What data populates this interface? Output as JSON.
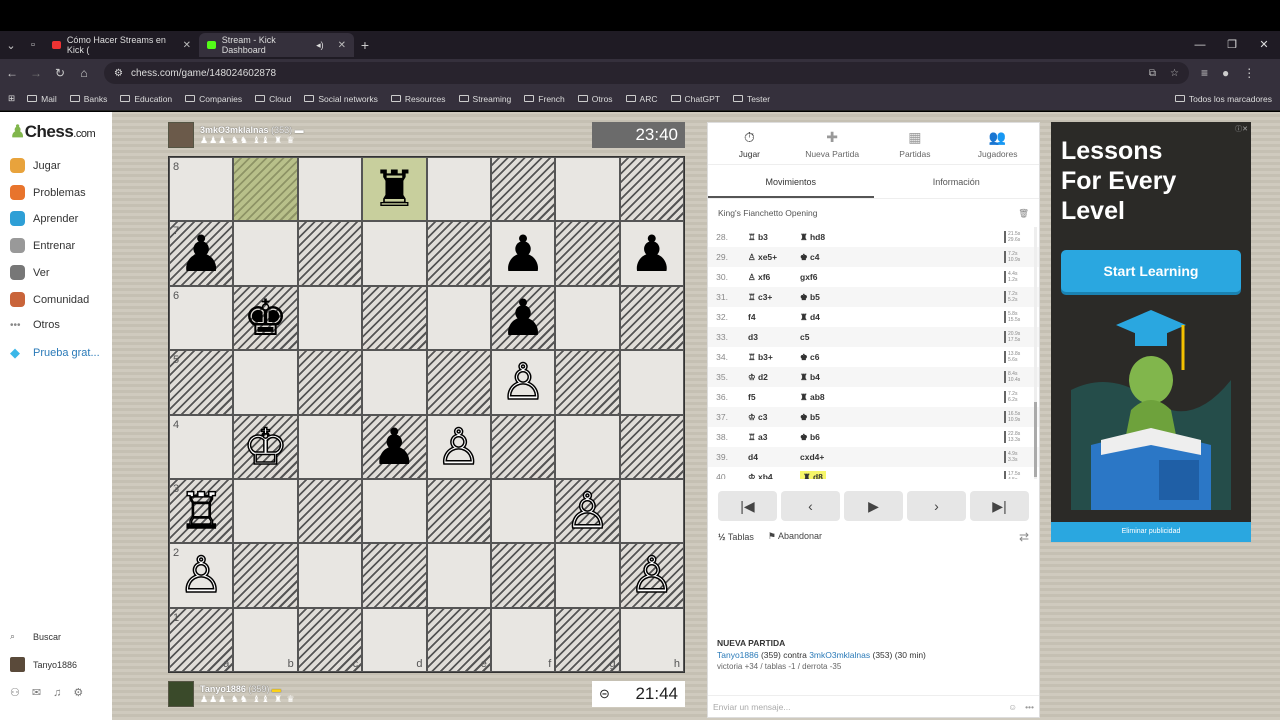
{
  "browser": {
    "tabs": [
      {
        "title": "Cómo Hacer Streams en Kick (",
        "active": false
      },
      {
        "title": "Stream - Kick Dashboard",
        "active": true
      }
    ],
    "url": "chess.com/game/148024602878",
    "bookmarks": [
      "Mail",
      "Banks",
      "Education",
      "Companies",
      "Cloud",
      "Social networks",
      "Resources",
      "Streaming",
      "French",
      "Otros",
      "ARC",
      "ChatGPT",
      "Tester"
    ],
    "bookmarks_right": "Todos los marcadores"
  },
  "sidebar": {
    "logo": "Chess",
    "logo_suffix": ".com",
    "items": [
      "Jugar",
      "Problemas",
      "Aprender",
      "Entrenar",
      "Ver",
      "Comunidad",
      "Otros",
      "Prueba grat..."
    ],
    "search": "Buscar",
    "user": "Tanyo1886"
  },
  "game": {
    "top_player": {
      "name": "3mkO3mklalnas",
      "rating": "(353)",
      "clock": "23:40"
    },
    "bottom_player": {
      "name": "Tanyo1886",
      "rating": "(359)",
      "clock": "21:44"
    },
    "ranks": [
      "8",
      "7",
      "6",
      "5",
      "4",
      "3",
      "2",
      "1"
    ],
    "files": [
      "a",
      "b",
      "c",
      "d",
      "e",
      "f",
      "g",
      "h"
    ]
  },
  "panel": {
    "tabs": [
      {
        "label": "Jugar",
        "icon": "stopwatch-icon",
        "glyph": "⏱"
      },
      {
        "label": "Nueva Partida",
        "icon": "plus-icon",
        "glyph": "✚"
      },
      {
        "label": "Partidas",
        "icon": "board-icon",
        "glyph": "▦"
      },
      {
        "label": "Jugadores",
        "icon": "users-icon",
        "glyph": "👥"
      }
    ],
    "subtabs": [
      "Movimientos",
      "Información"
    ],
    "opening": "King's Fianchetto Opening",
    "moves": [
      {
        "n": "28.",
        "w": "♖ b3",
        "b": "♜ hd8",
        "tw": "21.5s",
        "tb": "29.6s"
      },
      {
        "n": "29.",
        "w": "♙ xe5+",
        "b": "♚ c4",
        "tw": "7.2s",
        "tb": "10.9s"
      },
      {
        "n": "30.",
        "w": "♙ xf6",
        "b": "gxf6",
        "tw": "4.4s",
        "tb": "1.2s"
      },
      {
        "n": "31.",
        "w": "♖ c3+",
        "b": "♚ b5",
        "tw": "7.2s",
        "tb": "5.2s"
      },
      {
        "n": "32.",
        "w": "f4",
        "b": "♜ d4",
        "tw": "5.8s",
        "tb": "15.5s"
      },
      {
        "n": "33.",
        "w": "d3",
        "b": "c5",
        "tw": "20.9s",
        "tb": "17.5s"
      },
      {
        "n": "34.",
        "w": "♖ b3+",
        "b": "♚ c6",
        "tw": "13.8s",
        "tb": "5.6s"
      },
      {
        "n": "35.",
        "w": "♔ d2",
        "b": "♜ b4",
        "tw": "8.4s",
        "tb": "10.4s"
      },
      {
        "n": "36.",
        "w": "f5",
        "b": "♜ ab8",
        "tw": "7.2s",
        "tb": "6.2s"
      },
      {
        "n": "37.",
        "w": "♔ c3",
        "b": "♚ b5",
        "tw": "16.5s",
        "tb": "10.9s"
      },
      {
        "n": "38.",
        "w": "♖ a3",
        "b": "♚ b6",
        "tw": "22.8s",
        "tb": "13.3s"
      },
      {
        "n": "39.",
        "w": "d4",
        "b": "cxd4+",
        "tw": "4.9s",
        "tb": "3.3s"
      },
      {
        "n": "40.",
        "w": "♔ xb4",
        "b": "♜ d8",
        "tw": "17.5s",
        "tb": "4.5s"
      }
    ],
    "actions": {
      "draw": "Tablas",
      "draw_prefix": "½",
      "resign": "Abandonar"
    },
    "new_game": {
      "heading": "NUEVA PARTIDA",
      "p1": "Tanyo1886",
      "p1_rating": "(359)",
      "vs": "contra",
      "p2": "3mkO3mklalnas",
      "p2_rating": "(353)",
      "mode": "(30 min)",
      "stats": "victoria +34 / tablas -1 / derrota -35"
    },
    "chat_placeholder": "Enviar un mensaje..."
  },
  "ad": {
    "title_lines": [
      "Lessons",
      "For Every",
      "Level"
    ],
    "button": "Start Learning",
    "footer": "Eliminar publicidad"
  }
}
